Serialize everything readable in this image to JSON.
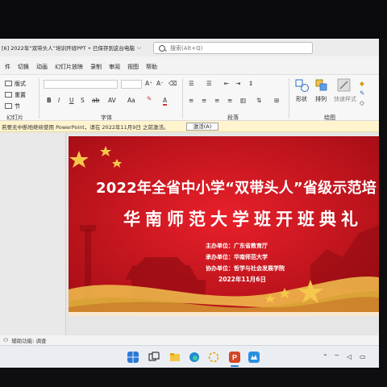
{
  "window": {
    "doc_title": "[6] 2022年“双带头人”培训开班PPT • 已保存到这台电脑",
    "chevron": "⌵"
  },
  "search": {
    "placeholder": "搜索(Alt+Q)"
  },
  "menu_tabs": [
    "件",
    "切换",
    "动画",
    "幻灯片放映",
    "录制",
    "审阅",
    "视图",
    "帮助"
  ],
  "ribbon": {
    "layout_label": "版式",
    "reset_label": "重置",
    "section_label": "节",
    "slides_group": "幻灯片",
    "font_group": "字体",
    "paragraph_group": "段落",
    "drawing_group": "绘图",
    "font_buttons": [
      "B",
      "I",
      "U",
      "S",
      "ab",
      "AV",
      "Aa",
      "A"
    ],
    "shape_label": "形状",
    "arrange_label": "排列",
    "quick_styles_label": "快速样式"
  },
  "notice": {
    "message": "若要无中断地继续使用 PowerPoint，请在 2022年11月9日 之前激活。",
    "button": "激活(A)"
  },
  "slide": {
    "title_line1": "2022年全省中小学“双带头人”省级示范培",
    "title_line2": "华南师范大学班开班典礼",
    "host": "主办单位：广东省教育厅",
    "organizer": "承办单位：华南师范大学",
    "co_organizer": "协办单位：哲学与社会发展学院",
    "date": "2022年11月6日"
  },
  "statusbar": {
    "accessibility": "辅助功能: 调查"
  },
  "colors": {
    "slide_red": "#c8141c",
    "gold": "#f2c14e",
    "notice_bg": "#fff4ce"
  }
}
